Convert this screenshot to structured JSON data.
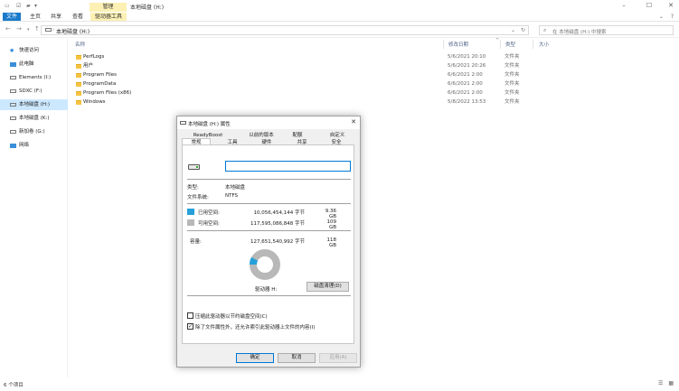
{
  "window": {
    "title": "本地磁盘 (H:)",
    "manage_tab": "管理"
  },
  "ribbon": {
    "tabs": [
      "文件",
      "主页",
      "共享",
      "查看",
      "驱动器工具"
    ]
  },
  "address": {
    "path": "本地磁盘 (H:)",
    "search_placeholder": "在 本地磁盘 (H:) 中搜索"
  },
  "sidebar": {
    "items": [
      {
        "label": "快速访问"
      },
      {
        "label": "此电脑"
      },
      {
        "label": "Elements (I:)"
      },
      {
        "label": "SDXC (F:)"
      },
      {
        "label": "本地磁盘 (H:)"
      },
      {
        "label": "本地磁盘 (K:)"
      },
      {
        "label": "新加卷 (G:)"
      },
      {
        "label": "网络"
      }
    ]
  },
  "files": {
    "columns": {
      "name": "名称",
      "date": "修改日期",
      "type": "类型",
      "size": "大小"
    },
    "rows": [
      {
        "name": "PerfLogs",
        "date": "5/6/2021 20:10",
        "type": "文件夹"
      },
      {
        "name": "用户",
        "date": "5/6/2021 20:26",
        "type": "文件夹"
      },
      {
        "name": "Program Files",
        "date": "6/6/2021 2:00",
        "type": "文件夹"
      },
      {
        "name": "ProgramData",
        "date": "6/6/2021 2:00",
        "type": "文件夹"
      },
      {
        "name": "Program Files (x86)",
        "date": "6/6/2021 2:00",
        "type": "文件夹"
      },
      {
        "name": "Windows",
        "date": "5/8/2022 13:53",
        "type": "文件夹"
      }
    ]
  },
  "status": {
    "count": "6 个项目"
  },
  "dialog": {
    "title": "本地磁盘 (H:) 属性",
    "tabs_row1": [
      "ReadyBoost",
      "以前的版本",
      "配额",
      "自定义"
    ],
    "tabs_row2": [
      "常规",
      "工具",
      "硬件",
      "共享",
      "安全"
    ],
    "volume_name": "",
    "type_label": "类型:",
    "type_value": "本地磁盘",
    "fs_label": "文件系统:",
    "fs_value": "NTFS",
    "used_label": "已用空间:",
    "used_bytes": "10,056,454,144 字节",
    "used_gb": "9.36 GB",
    "free_label": "可用空间:",
    "free_bytes": "117,595,086,848 字节",
    "free_gb": "109 GB",
    "capacity_label": "容量:",
    "capacity_bytes": "127,651,540,992 字节",
    "capacity_gb": "118 GB",
    "used_fraction": 0.0788,
    "used_color": "#26a0da",
    "free_color": "#b8b8b8",
    "drive_label": "驱动器 H:",
    "cleanup_button": "磁盘清理(D)",
    "compress_label": "压缩此驱动器以节约磁盘空间(C)",
    "compress_checked": false,
    "index_label": "除了文件属性外，还允许索引此驱动器上文件的内容(I)",
    "index_checked": true,
    "ok": "确定",
    "cancel": "取消",
    "apply": "应用(A)"
  }
}
